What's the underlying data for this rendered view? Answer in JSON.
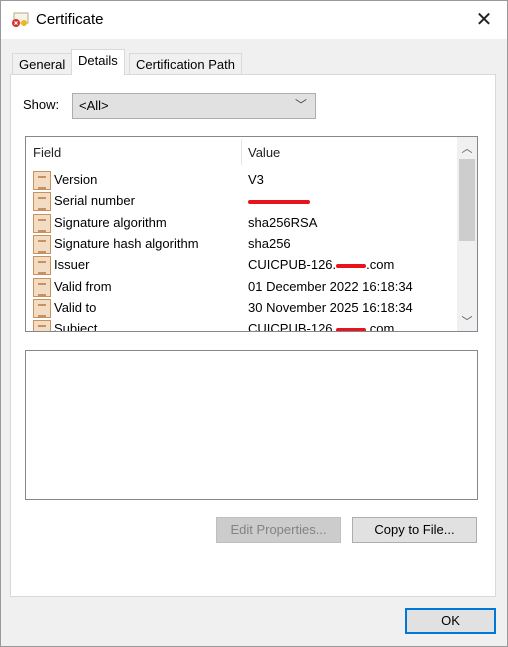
{
  "window": {
    "title": "Certificate",
    "icon": "certificate-error-icon",
    "close_icon": "close-icon"
  },
  "tabs": [
    {
      "label": "General"
    },
    {
      "label": "Details",
      "active": true
    },
    {
      "label": "Certification Path"
    }
  ],
  "show": {
    "label": "Show:",
    "value": "<All>"
  },
  "list": {
    "headers": {
      "field": "Field",
      "value": "Value"
    },
    "rows": [
      {
        "field": "Version",
        "value": "V3"
      },
      {
        "field": "Serial number",
        "value": "",
        "redacted": true
      },
      {
        "field": "Signature algorithm",
        "value": "sha256RSA"
      },
      {
        "field": "Signature hash algorithm",
        "value": "sha256"
      },
      {
        "field": "Issuer",
        "value": "CUICPUB-126.",
        "suffix": ".com",
        "redacted": true
      },
      {
        "field": "Valid from",
        "value": "01 December 2022 16:18:34"
      },
      {
        "field": "Valid to",
        "value": "30 November 2025 16:18:34"
      },
      {
        "field": "Subject",
        "value": "CUICPUB-126.",
        "suffix": ".com",
        "redacted": true
      }
    ]
  },
  "buttons": {
    "edit_properties": "Edit Properties...",
    "copy_to_file": "Copy to File...",
    "ok": "OK"
  },
  "colors": {
    "redaction": "#e8141b",
    "focus": "#0078d7"
  }
}
